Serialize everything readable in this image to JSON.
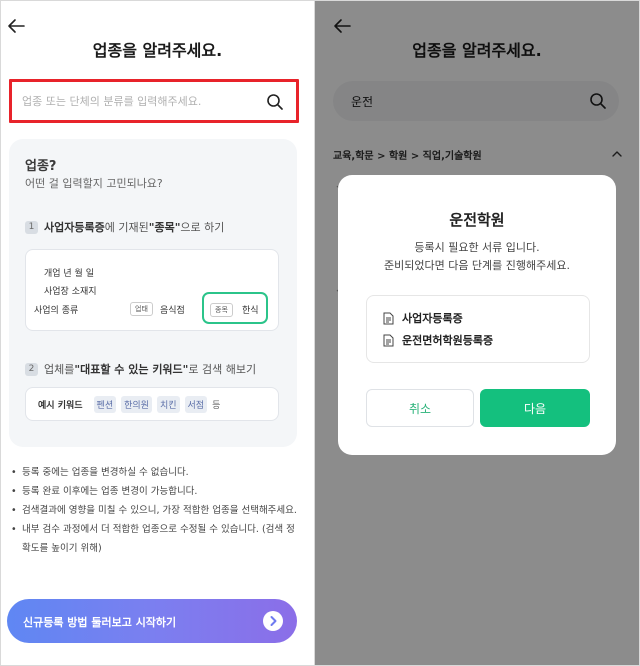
{
  "left": {
    "title": "업종을 알려주세요.",
    "search_placeholder": "업종 또는 단체의 분류를 입력해주세요.",
    "guide": {
      "heading": "업종?",
      "subheading": "어떤 걸 입력할지 고민되나요?",
      "step1": {
        "num": "1",
        "pre": "사업자등록증",
        "mid": "에 기재된 ",
        "bold": "\"종목\"",
        "post": "으로 하기"
      },
      "card1": {
        "line1": "개업 년 월 일",
        "line2": "사업장 소재지",
        "line3": "사업의 종류",
        "tag_business": "업태",
        "business_value": "음식점",
        "tag_item": "종목",
        "item_value": "한식"
      },
      "step2": {
        "num": "2",
        "pre": "업체를 ",
        "bold": "\"대표할 수 있는 키워드\"",
        "post": "로 검색 해보기"
      },
      "card2": {
        "label": "예시 키워드",
        "keywords": [
          "펜션",
          "한의원",
          "치킨",
          "서점"
        ],
        "suffix": "등"
      }
    },
    "notes": [
      "등록 중에는 업종을 변경하실 수 없습니다.",
      "등록 완료 이후에는 업종 변경이 가능합니다.",
      "검색결과에 영향을 미칠 수 있으니, 가장 적합한 업종을 선택해주세요.",
      "내부 검수 과정에서 더 적합한 업종으로 수정될 수 있습니다. (검색 정확도를 높이기 위해)"
    ],
    "cta_label": "신규등록 방법 둘러보고 시작하기"
  },
  "right": {
    "title": "업종을 알려주세요.",
    "search_value": "운전",
    "breadcrumb": "교육,학문 > 학원 > 직업,기술학원",
    "modal": {
      "title": "운전학원",
      "desc_line1": "등록시 필요한 서류 입니다.",
      "desc_line2": "준비되었다면 다음 단계를 진행해주세요.",
      "docs": [
        "사업자등록증",
        "운전면허학원등록증"
      ],
      "cancel_label": "취소",
      "next_label": "다음"
    }
  },
  "colors": {
    "highlight_red": "#e8232a",
    "accent_green": "#14c07e",
    "cta_gradient_start": "#5f87f3",
    "cta_gradient_end": "#8b6ee8"
  }
}
